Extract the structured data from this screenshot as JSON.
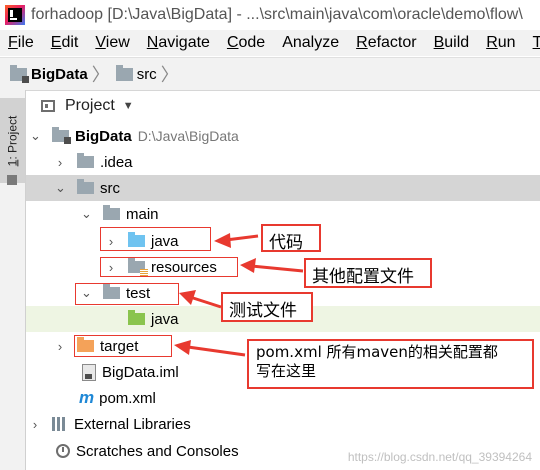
{
  "window": {
    "title": "forhadoop [D:\\Java\\BigData] - ...\\src\\main\\java\\com\\oracle\\demo\\flow\\"
  },
  "menu": [
    {
      "mn": "F",
      "rest": "ile"
    },
    {
      "mn": "E",
      "rest": "dit"
    },
    {
      "mn": "V",
      "rest": "iew"
    },
    {
      "mn": "N",
      "rest": "avigate"
    },
    {
      "mn": "C",
      "rest": "ode"
    },
    {
      "mn": "",
      "rest": "Analyze"
    },
    {
      "mn": "R",
      "rest": "efactor"
    },
    {
      "mn": "B",
      "rest": "uild"
    },
    {
      "mn": "R",
      "rest": "un"
    },
    {
      "mn": "T",
      "rest": "o"
    }
  ],
  "breadcrumb": {
    "project": "BigData",
    "folder": "src"
  },
  "sidebar": {
    "tab_mn": "1",
    "tab_rest": ": Project"
  },
  "panel": {
    "title": "Project"
  },
  "tree": {
    "root": "BigData",
    "root_path": "D:\\Java\\BigData",
    "idea": ".idea",
    "src": "src",
    "main": "main",
    "java": "java",
    "resources": "resources",
    "test": "test",
    "test_java": "java",
    "target": "target",
    "iml": "BigData.iml",
    "pom": "pom.xml",
    "ext_libs": "External Libraries",
    "scratches": "Scratches and Consoles"
  },
  "annotations": {
    "code": "代码",
    "config": "其他配置文件",
    "test": "测试文件",
    "pom_line1": "pom.xml 所有maven的相关配置都",
    "pom_line2": "写在这里"
  },
  "watermark": "https://blog.csdn.net/qq_39394264",
  "colors": {
    "annotation_red": "#e8392f",
    "selection": "#d5d5d5",
    "test_highlight": "#eef5e3"
  }
}
